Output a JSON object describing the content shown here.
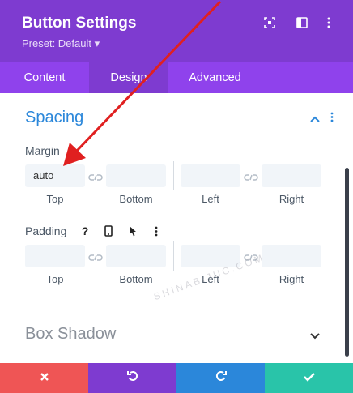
{
  "header": {
    "title": "Button Settings",
    "preset": "Preset: Default ▾"
  },
  "tabs": [
    {
      "label": "Content"
    },
    {
      "label": "Design"
    },
    {
      "label": "Advanced"
    }
  ],
  "spacing": {
    "title": "Spacing",
    "margin": {
      "label": "Margin",
      "top_value": "auto",
      "top": "Top",
      "bottom": "Bottom",
      "left": "Left",
      "right": "Right"
    },
    "padding": {
      "label": "Padding",
      "help": "?",
      "top": "Top",
      "bottom": "Bottom",
      "left": "Left",
      "right": "Right"
    }
  },
  "box_shadow": {
    "title": "Box Shadow"
  },
  "watermark": "SHINABIJUC.COM",
  "colors": {
    "header": "#7e3bd0",
    "tabs": "#8f42ec",
    "accent": "#2b87da",
    "cancel": "#ef5555",
    "undo": "#7e3bd0",
    "redo": "#2b87da",
    "save": "#29c4a9",
    "arrow": "#e02020"
  },
  "icons": {
    "header": [
      "focus-icon",
      "split-view-icon",
      "more-vertical-icon"
    ],
    "footer": [
      "close-icon",
      "undo-icon",
      "redo-icon",
      "check-icon"
    ]
  }
}
